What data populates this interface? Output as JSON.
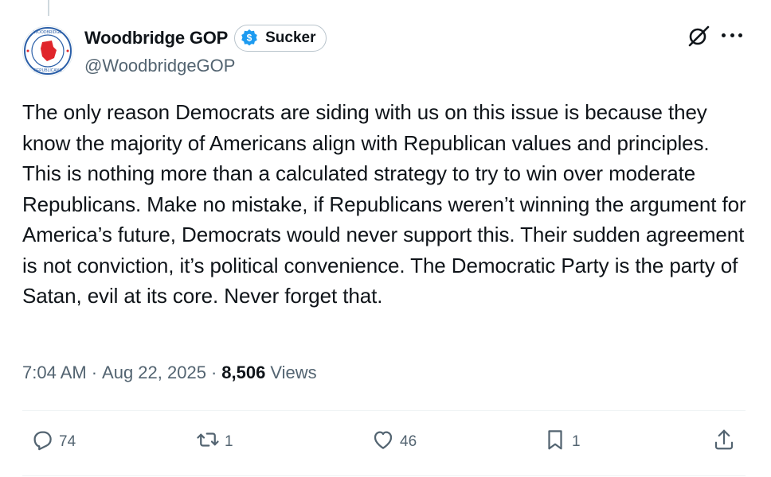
{
  "author": {
    "display_name": "Woodbridge GOP",
    "handle": "@WoodbridgeGOP",
    "badge_label": "Sucker",
    "avatar_icon": "woodbridge-republican-seal",
    "badge_color": "#1d9bf0"
  },
  "tweet": {
    "text": "The only reason Democrats are siding with us on this issue is because they know the majority of Americans align with Republican values and principles. This is nothing more than a calculated strategy to try to win over moderate Republicans. Make no mistake, if Republicans weren’t winning the argument for America’s future, Democrats would never support this. Their sudden agreement is not conviction, it’s political convenience. The Democratic Party is the party of Satan, evil at its core. Never forget that."
  },
  "meta": {
    "time": "7:04 AM",
    "separator": "·",
    "date": "Aug 22, 2025",
    "views_count": "8,506",
    "views_label": "Views"
  },
  "actions": {
    "replies": "74",
    "reposts": "1",
    "likes": "46",
    "bookmarks": "1"
  },
  "icons": {
    "header": [
      "grok-icon",
      "more-icon"
    ],
    "actions": [
      "reply-icon",
      "repost-icon",
      "like-icon",
      "bookmark-icon",
      "share-icon"
    ]
  }
}
